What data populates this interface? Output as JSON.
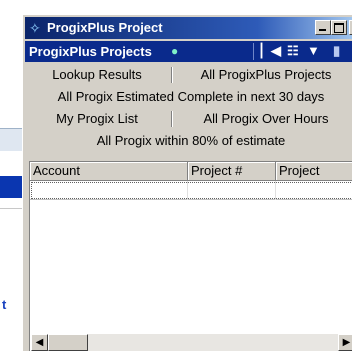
{
  "window": {
    "title": "ProgixPlus Project"
  },
  "toolbar": {
    "title": "ProgixPlus Projects",
    "nav_first_icon": "skip-first-icon",
    "view_icon": "grid-view-icon",
    "dropdown_icon": "chevron-down-icon",
    "extra_icon": "panel-icon"
  },
  "tabs": {
    "row1": [
      "Lookup Results",
      "All ProgixPlus Projects"
    ],
    "row2": [
      "All Progix Estimated Complete in next 30 days"
    ],
    "row3": [
      "My Progix List",
      "All Progix Over Hours"
    ],
    "row4": [
      "All Progix within 80% of estimate"
    ]
  },
  "table": {
    "columns": [
      "Account",
      "Project #",
      "Project"
    ]
  },
  "background": {
    "left_text": "t"
  },
  "colors": {
    "title_bar": "#0a246a",
    "toolbar": "#0a2a8c",
    "window_face": "#d4d0c8"
  }
}
